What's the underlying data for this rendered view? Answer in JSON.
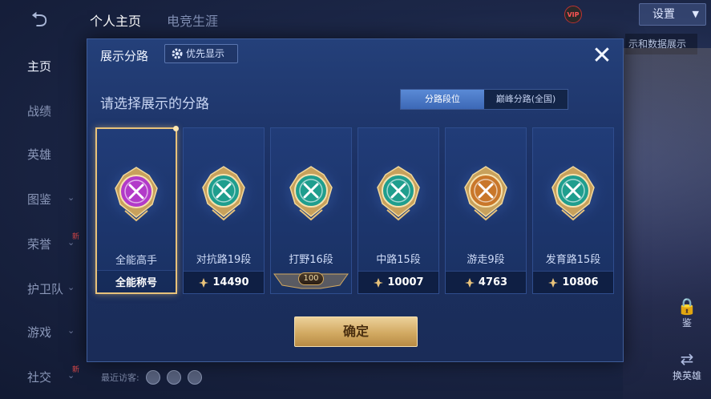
{
  "header": {
    "tabs": [
      {
        "label": "个人主页",
        "active": true
      },
      {
        "label": "电竞生涯",
        "active": false
      }
    ],
    "settings_label": "设置",
    "vip_badge": "VIP",
    "background_tip": "示和数据展示"
  },
  "left_nav": [
    {
      "label": "主页",
      "active": true,
      "has_chevron": false,
      "new": false
    },
    {
      "label": "战绩",
      "active": false,
      "has_chevron": false,
      "new": false
    },
    {
      "label": "英雄",
      "active": false,
      "has_chevron": false,
      "new": false
    },
    {
      "label": "图鉴",
      "active": false,
      "has_chevron": true,
      "new": false
    },
    {
      "label": "荣誉",
      "active": false,
      "has_chevron": true,
      "new": true
    },
    {
      "label": "护卫队",
      "active": false,
      "has_chevron": true,
      "new": false
    },
    {
      "label": "游戏",
      "active": false,
      "has_chevron": true,
      "new": false
    },
    {
      "label": "社交",
      "active": false,
      "has_chevron": true,
      "new": true
    }
  ],
  "new_marker": "新",
  "side_buttons": {
    "inspect_label": "鉴",
    "switch_hero_label": "换英雄"
  },
  "bottom": {
    "recent_visitors_label": "最近访客:"
  },
  "modal": {
    "title": "展示分路",
    "priority_button": "优先显示",
    "prompt": "请选择展示的分路",
    "toggle": [
      {
        "label": "分路段位",
        "active": true
      },
      {
        "label": "巅峰分路(全国)",
        "active": false
      }
    ],
    "lanes": [
      {
        "name": "全能高手",
        "footer_title": "全能称号",
        "points": null,
        "selected": true,
        "emblem": "all-round-emblem-icon",
        "color": "#b23ac9"
      },
      {
        "name": "对抗路19段",
        "footer_title": null,
        "points": "14490",
        "selected": false,
        "emblem": "clash-lane-emblem-icon",
        "color": "#1f9e8e"
      },
      {
        "name": "打野16段",
        "footer_title": null,
        "points": null,
        "badge": "100",
        "selected": false,
        "emblem": "jungle-emblem-icon",
        "color": "#1f9e8e"
      },
      {
        "name": "中路15段",
        "footer_title": null,
        "points": "10007",
        "selected": false,
        "emblem": "mid-lane-emblem-icon",
        "color": "#1f9e8e"
      },
      {
        "name": "游走9段",
        "footer_title": null,
        "points": "4763",
        "selected": false,
        "emblem": "roam-emblem-icon",
        "color": "#c9772a"
      },
      {
        "name": "发育路15段",
        "footer_title": null,
        "points": "10806",
        "selected": false,
        "emblem": "farm-lane-emblem-icon",
        "color": "#1f9e8e"
      }
    ],
    "confirm_button": "确定"
  },
  "colors": {
    "accent_gold": "#e8c27a",
    "modal_bg": "#1c3164",
    "purple_emblem": "#b23ac9",
    "teal_emblem": "#1f9e8e",
    "orange_emblem": "#c9772a"
  }
}
